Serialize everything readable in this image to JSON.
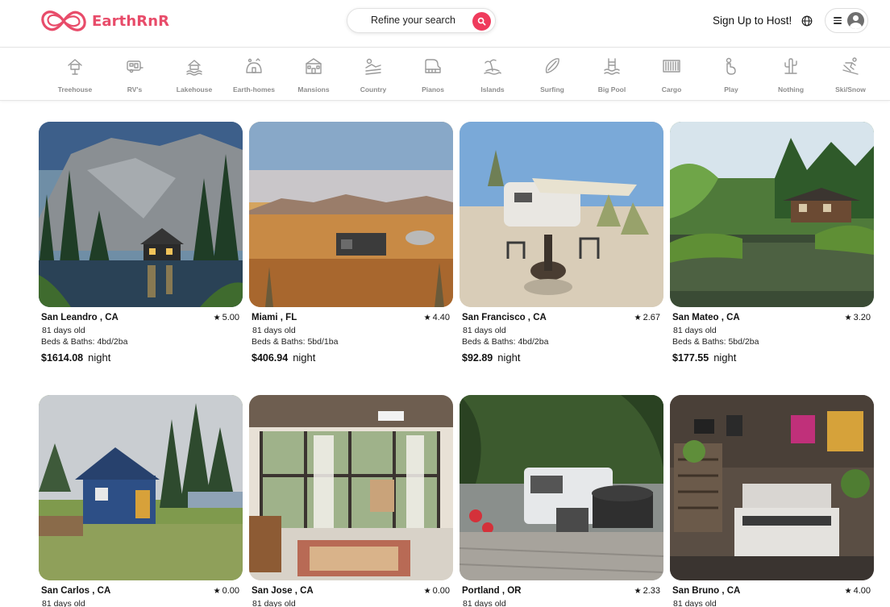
{
  "header": {
    "logo_text": "EarthRnR",
    "search_label": "Refine your search",
    "host_link": "Sign Up to Host!"
  },
  "colors": {
    "brand": "#e84c6a",
    "search_button": "#ef3b5c",
    "icon_gray": "#9a9a9a"
  },
  "categories": [
    {
      "label": "Treehouse",
      "icon": "treehouse-icon"
    },
    {
      "label": "RV's",
      "icon": "rv-icon"
    },
    {
      "label": "Lakehouse",
      "icon": "lakehouse-icon"
    },
    {
      "label": "Earth-homes",
      "icon": "earth-home-icon"
    },
    {
      "label": "Mansions",
      "icon": "mansion-icon"
    },
    {
      "label": "Country",
      "icon": "country-icon"
    },
    {
      "label": "Pianos",
      "icon": "piano-icon"
    },
    {
      "label": "Islands",
      "icon": "island-icon"
    },
    {
      "label": "Surfing",
      "icon": "surfboard-icon"
    },
    {
      "label": "Big Pool",
      "icon": "pool-icon"
    },
    {
      "label": "Cargo",
      "icon": "cargo-container-icon"
    },
    {
      "label": "Play",
      "icon": "play-icon"
    },
    {
      "label": "Nothing",
      "icon": "cactus-icon"
    },
    {
      "label": "Ski/Snow",
      "icon": "skiing-icon"
    }
  ],
  "listings": [
    {
      "location": "San Leandro , CA",
      "rating": "5.00",
      "age": "81 days old",
      "beds": "Beds & Baths: 4bd/2ba",
      "price": "$1614.08",
      "unit": "night",
      "photo": "lake-cabin-photo"
    },
    {
      "location": "Miami , FL",
      "rating": "4.40",
      "age": "81 days old",
      "beds": "Beds & Baths: 5bd/1ba",
      "price": "$406.94",
      "unit": "night",
      "photo": "desert-cabin-photo"
    },
    {
      "location": "San Francisco , CA",
      "rating": "2.67",
      "age": "81 days old",
      "beds": "Beds & Baths: 4bd/2ba",
      "price": "$92.89",
      "unit": "night",
      "photo": "desert-camper-photo"
    },
    {
      "location": "San Mateo , CA",
      "rating": "3.20",
      "age": "81 days old",
      "beds": "Beds & Baths: 5bd/2ba",
      "price": "$177.55",
      "unit": "night",
      "photo": "pond-house-photo"
    },
    {
      "location": "San Carlos , CA",
      "rating": "0.00",
      "age": "81 days old",
      "photo": "blue-cabin-photo"
    },
    {
      "location": "San Jose , CA",
      "rating": "0.00",
      "age": "81 days old",
      "photo": "sunroom-photo"
    },
    {
      "location": "Portland , OR",
      "rating": "2.33",
      "age": "81 days old",
      "photo": "rv-patio-photo"
    },
    {
      "location": "San Bruno , CA",
      "rating": "4.00",
      "age": "81 days old",
      "photo": "workshop-photo"
    }
  ]
}
